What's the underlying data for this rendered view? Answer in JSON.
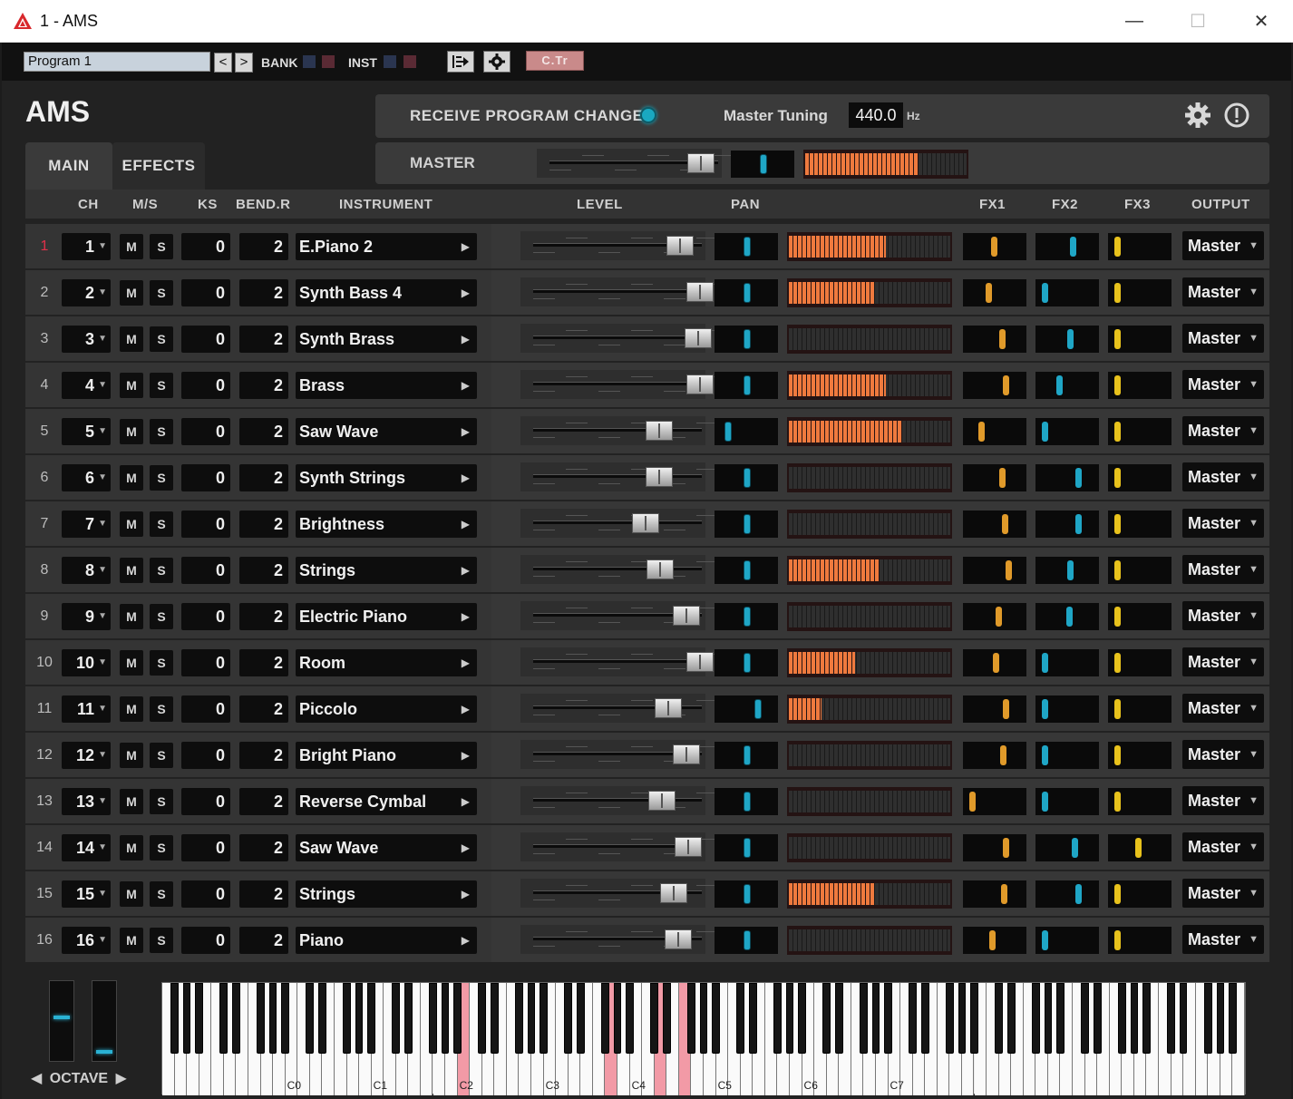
{
  "window": {
    "title": "1 - AMS",
    "minimize": "—",
    "maximize": "☐",
    "close": "✕"
  },
  "toolbar": {
    "program": "Program 1",
    "prev": "<",
    "next": ">",
    "bank_label": "BANK",
    "inst_label": "INST",
    "ctr_label": "C.Tr",
    "bank_colors": [
      "#2a3550",
      "#5a2a34"
    ],
    "inst_colors": [
      "#2a3550",
      "#5a2a34"
    ]
  },
  "header": {
    "app_title": "AMS",
    "receive_program_change": "RECEIVE PROGRAM CHANGE",
    "master_tuning_label": "Master Tuning",
    "master_tuning_value": "440.0",
    "master_tuning_unit": "Hz"
  },
  "tabs": {
    "main": "MAIN",
    "effects": "EFFECTS"
  },
  "master": {
    "label": "MASTER",
    "level": 0.88,
    "pan": 0.5,
    "meter": 0.7
  },
  "columns": {
    "ch": "CH",
    "ms": "M/S",
    "ks": "KS",
    "bend": "BEND.R",
    "instrument": "INSTRUMENT",
    "level": "LEVEL",
    "pan": "PAN",
    "fx1": "FX1",
    "fx2": "FX2",
    "fx3": "FX3",
    "output": "OUTPUT"
  },
  "labels": {
    "mute": "M",
    "solo": "S"
  },
  "colors": {
    "pan": "#1fa6c6",
    "fx1": "#e09a2a",
    "fx2": "#1fa6c6",
    "fx3": "#e8c21c",
    "meter": "#ef7a3e",
    "selected_channel": "#e0304a"
  },
  "channels": [
    {
      "ch": "1",
      "ks": "0",
      "bend": "2",
      "instrument": "E.Piano 2",
      "level": 0.85,
      "pan": 0.5,
      "meter": 0.6,
      "fx1": 0.5,
      "fx2": 0.62,
      "fx3": 0.08,
      "output": "Master"
    },
    {
      "ch": "2",
      "ks": "0",
      "bend": "2",
      "instrument": "Synth Bass 4",
      "level": 0.97,
      "pan": 0.5,
      "meter": 0.53,
      "fx1": 0.39,
      "fx2": 0.08,
      "fx3": 0.08,
      "output": "Master"
    },
    {
      "ch": "3",
      "ks": "0",
      "bend": "2",
      "instrument": "Synth Brass",
      "level": 0.96,
      "pan": 0.5,
      "meter": 0,
      "fx1": 0.65,
      "fx2": 0.57,
      "fx3": 0.08,
      "output": "Master"
    },
    {
      "ch": "4",
      "ks": "0",
      "bend": "2",
      "instrument": "Brass",
      "level": 0.97,
      "pan": 0.5,
      "meter": 0.6,
      "fx1": 0.72,
      "fx2": 0.37,
      "fx3": 0.08,
      "output": "Master"
    },
    {
      "ch": "5",
      "ks": "0",
      "bend": "2",
      "instrument": "Saw Wave",
      "level": 0.72,
      "pan": 0.12,
      "meter": 0.7,
      "fx1": 0.25,
      "fx2": 0.08,
      "fx3": 0.08,
      "output": "Master"
    },
    {
      "ch": "6",
      "ks": "0",
      "bend": "2",
      "instrument": "Synth Strings",
      "level": 0.72,
      "pan": 0.5,
      "meter": 0,
      "fx1": 0.65,
      "fx2": 0.72,
      "fx3": 0.08,
      "output": "Master"
    },
    {
      "ch": "7",
      "ks": "0",
      "bend": "2",
      "instrument": "Brightness",
      "level": 0.64,
      "pan": 0.5,
      "meter": 0,
      "fx1": 0.7,
      "fx2": 0.72,
      "fx3": 0.08,
      "output": "Master"
    },
    {
      "ch": "8",
      "ks": "0",
      "bend": "2",
      "instrument": "Strings",
      "level": 0.73,
      "pan": 0.5,
      "meter": 0.56,
      "fx1": 0.78,
      "fx2": 0.57,
      "fx3": 0.08,
      "output": "Master"
    },
    {
      "ch": "9",
      "ks": "0",
      "bend": "2",
      "instrument": "Electric Piano",
      "level": 0.89,
      "pan": 0.5,
      "meter": 0,
      "fx1": 0.59,
      "fx2": 0.55,
      "fx3": 0.08,
      "output": "Master"
    },
    {
      "ch": "10",
      "ks": "0",
      "bend": "2",
      "instrument": "Room",
      "level": 0.97,
      "pan": 0.5,
      "meter": 0.41,
      "fx1": 0.54,
      "fx2": 0.08,
      "fx3": 0.08,
      "output": "Master"
    },
    {
      "ch": "11",
      "ks": "0",
      "bend": "2",
      "instrument": "Piccolo",
      "level": 0.78,
      "pan": 0.72,
      "meter": 0.2,
      "fx1": 0.73,
      "fx2": 0.08,
      "fx3": 0.08,
      "output": "Master"
    },
    {
      "ch": "12",
      "ks": "0",
      "bend": "2",
      "instrument": "Bright Piano",
      "level": 0.89,
      "pan": 0.5,
      "meter": 0,
      "fx1": 0.67,
      "fx2": 0.08,
      "fx3": 0.08,
      "output": "Master"
    },
    {
      "ch": "13",
      "ks": "0",
      "bend": "2",
      "instrument": "Reverse Cymbal",
      "level": 0.74,
      "pan": 0.5,
      "meter": 0,
      "fx1": 0.08,
      "fx2": 0.08,
      "fx3": 0.08,
      "output": "Master"
    },
    {
      "ch": "14",
      "ks": "0",
      "bend": "2",
      "instrument": "Saw Wave",
      "level": 0.9,
      "pan": 0.5,
      "meter": 0,
      "fx1": 0.72,
      "fx2": 0.65,
      "fx3": 0.48,
      "output": "Master"
    },
    {
      "ch": "15",
      "ks": "0",
      "bend": "2",
      "instrument": "Strings",
      "level": 0.81,
      "pan": 0.5,
      "meter": 0.53,
      "fx1": 0.69,
      "fx2": 0.72,
      "fx3": 0.08,
      "output": "Master"
    },
    {
      "ch": "16",
      "ks": "0",
      "bend": "2",
      "instrument": "Piano",
      "level": 0.84,
      "pan": 0.5,
      "meter": 0,
      "fx1": 0.47,
      "fx2": 0.08,
      "fx3": 0.08,
      "output": "Master"
    }
  ],
  "octave": {
    "label": "OCTAVE",
    "prev": "◀",
    "next": "▶",
    "slider1": 0.45,
    "slider2": 0.95
  },
  "keyboard": {
    "octave_labels": [
      "C0",
      "C1",
      "C2",
      "C3",
      "C4",
      "C5",
      "C6",
      "C7"
    ],
    "pressed_white": [
      24,
      36,
      40,
      42
    ],
    "pressed_black": []
  }
}
